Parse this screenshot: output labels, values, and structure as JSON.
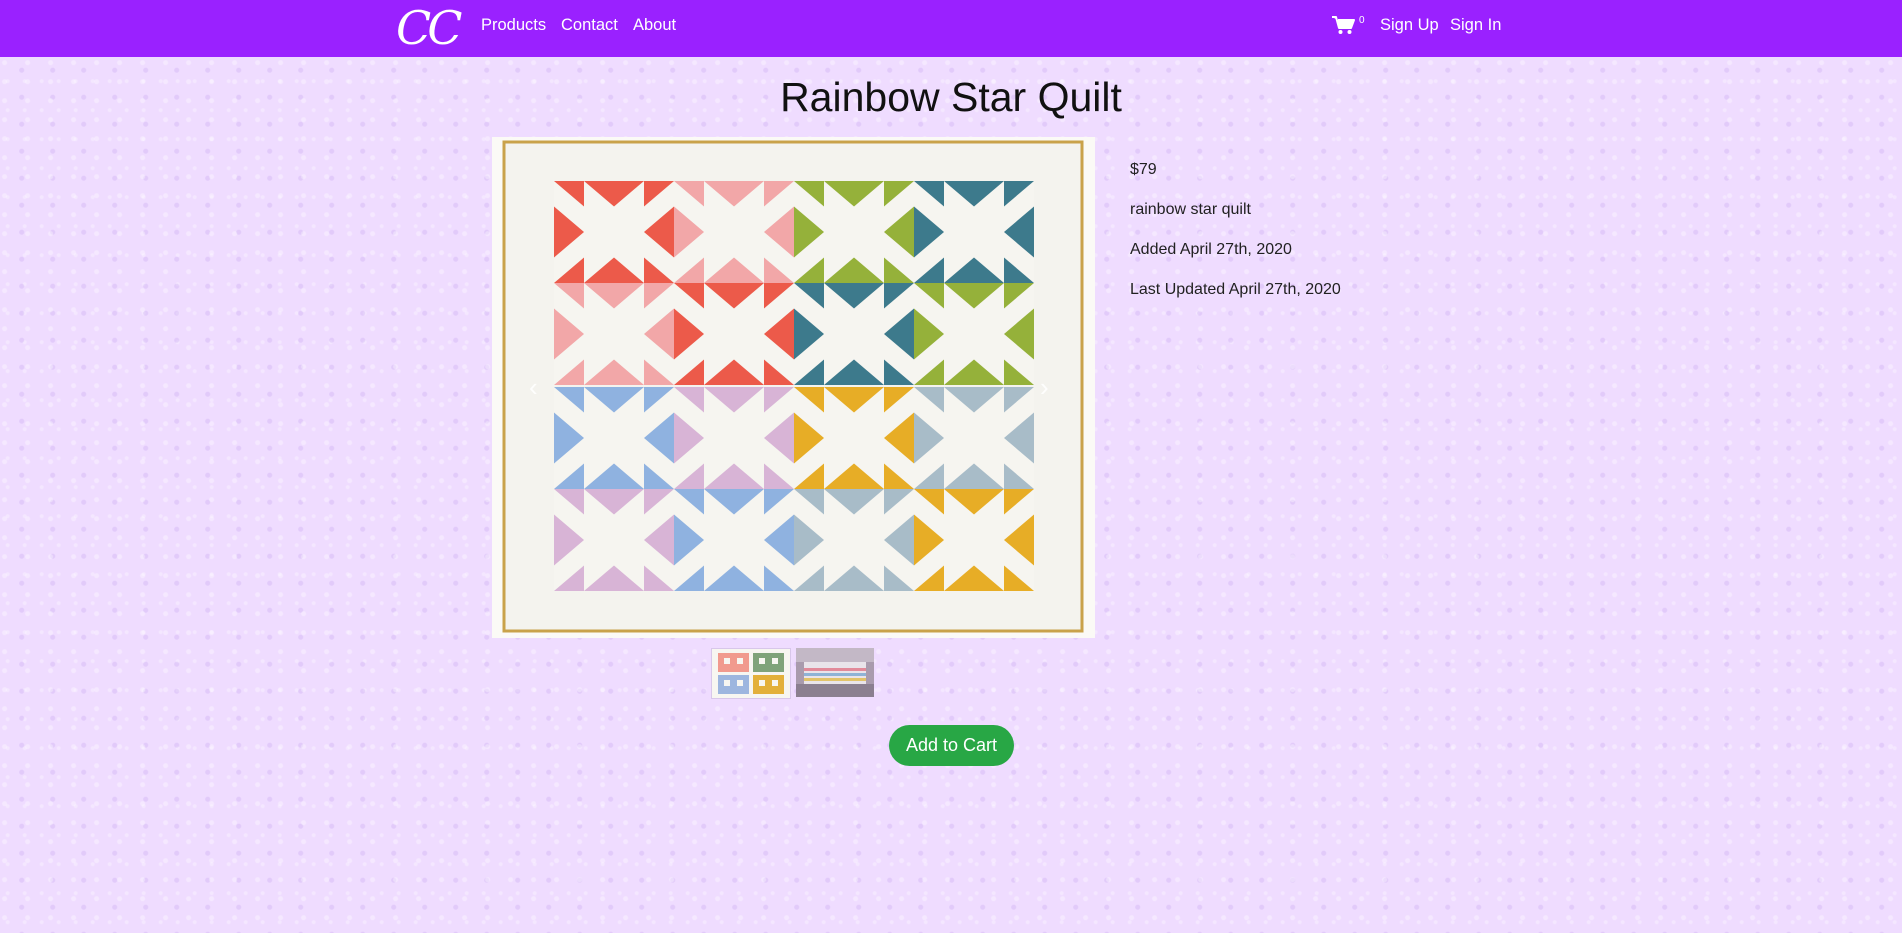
{
  "nav": {
    "brand": "CC",
    "links": [
      "Products",
      "Contact",
      "About"
    ],
    "cart_count": "0",
    "sign_up": "Sign Up",
    "sign_in": "Sign In",
    "color": "#9a21ff"
  },
  "product": {
    "title": "Rainbow Star Quilt",
    "price": "$79",
    "description": "rainbow star quilt",
    "added": "Added April 27th, 2020",
    "updated": "Last Updated April 27th, 2020"
  },
  "carousel": {
    "prev_icon": "chevron-left-icon",
    "next_icon": "chevron-right-icon",
    "thumbnails": [
      "quilt-thumbnail",
      "bed-thumbnail"
    ]
  },
  "actions": {
    "add_to_cart": "Add to Cart",
    "button_color": "#28a745"
  },
  "colors": {
    "page_background": "#efdcff"
  }
}
